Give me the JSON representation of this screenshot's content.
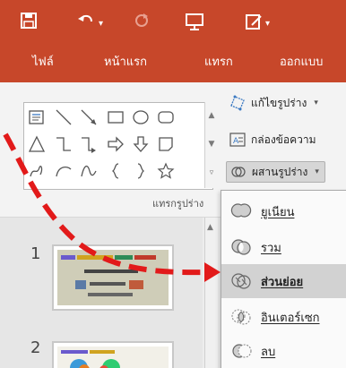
{
  "quick_access": {
    "save_icon": "save-icon",
    "undo_icon": "undo-icon",
    "redo_icon": "redo-icon",
    "present_icon": "present-icon",
    "draw_icon": "draw-icon"
  },
  "tabs": [
    {
      "label": "ไฟล์"
    },
    {
      "label": "หน้าแรก"
    },
    {
      "label": "แทรก"
    },
    {
      "label": "ออกแบบ"
    }
  ],
  "shapes_group": {
    "label": "แทรกรูปร่าง"
  },
  "commands": {
    "edit_shape": "แก้ไขรูปร่าง",
    "text_box": "กล่องข้อความ",
    "merge_shapes": "ผสานรูปร่าง"
  },
  "merge_menu": {
    "items": [
      {
        "label": "ยูเนียน",
        "icon": "union-icon"
      },
      {
        "label": "รวม",
        "icon": "combine-icon"
      },
      {
        "label": "ส่วนย่อย",
        "icon": "fragment-icon",
        "selected": true
      },
      {
        "label": "อินเตอร์เซก",
        "icon": "intersect-icon"
      },
      {
        "label": "ลบ",
        "icon": "subtract-icon"
      }
    ]
  },
  "slides": [
    {
      "number": "1"
    },
    {
      "number": "2"
    }
  ],
  "colors": {
    "ribbon": "#c7472a",
    "annotation_arrow": "#e21a1a"
  }
}
